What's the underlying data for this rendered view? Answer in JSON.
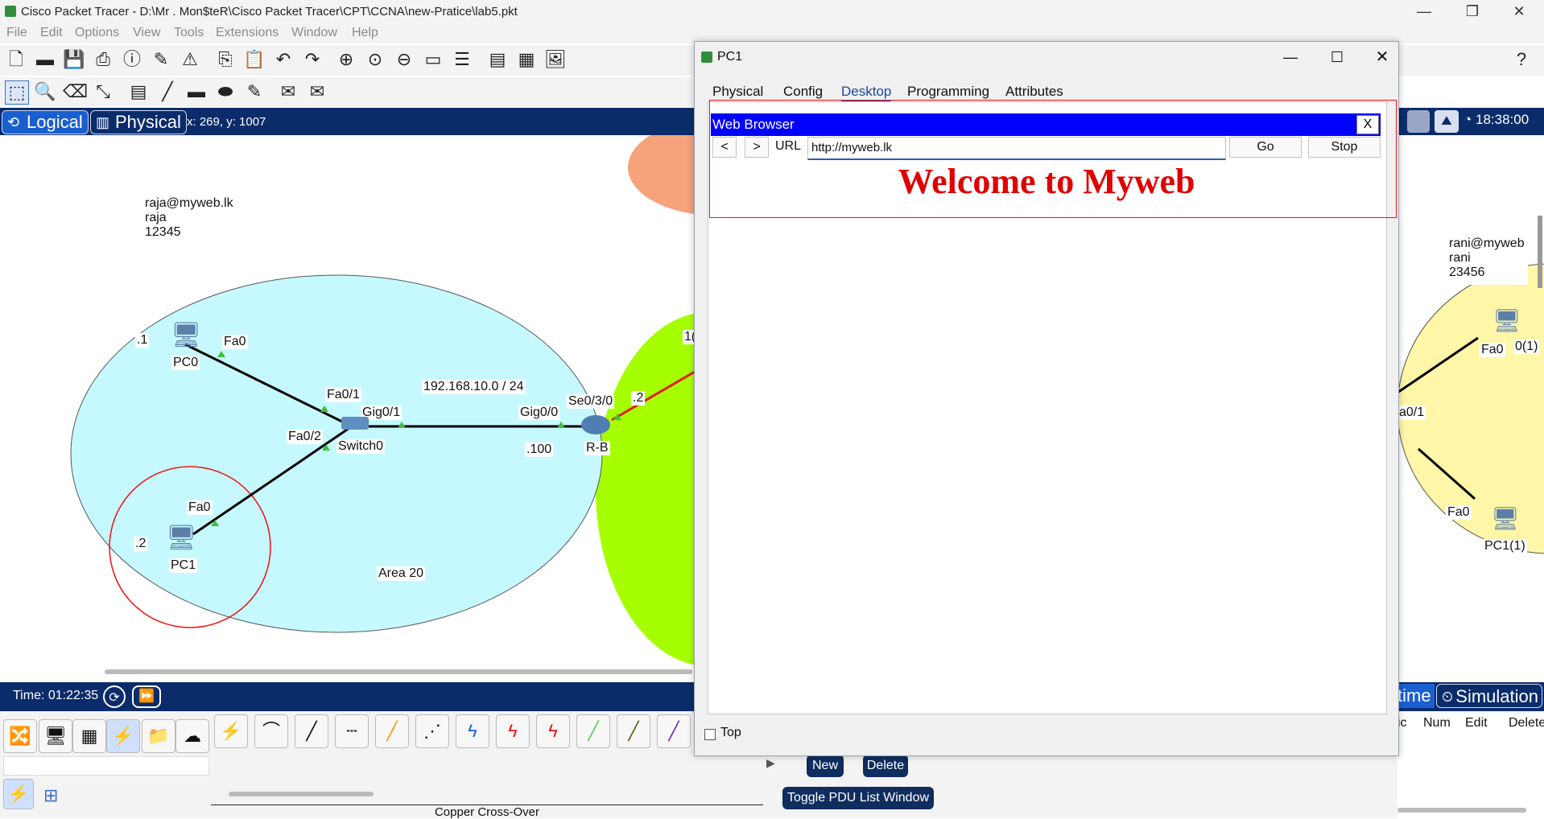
{
  "app": {
    "title": "Cisco Packet Tracer - D:\\Mr . Mon$teR\\Cisco Packet Tracer\\CPT\\CCNA\\new-Pratice\\lab5.pkt",
    "menu": [
      "File",
      "Edit",
      "Options",
      "View",
      "Tools",
      "Extensions",
      "Window",
      "Help"
    ]
  },
  "modes": {
    "logical": "Logical",
    "physical": "Physical",
    "coords": "x: 269, y: 1007",
    "clock": "18:38:00"
  },
  "topology": {
    "raja_note": [
      "raja@myweb.lk",
      "raja",
      "12345"
    ],
    "rani_note": [
      "rani@myweb",
      "rani",
      "23456"
    ],
    "devices": {
      "pc0": "PC0",
      "pc1": "PC1",
      "switch0": "Switch0",
      "router": "R-B",
      "pc1_1": "PC1(1)",
      "pc0_1": "0(1)"
    },
    "labels": {
      "pc0_port": "Fa0",
      "pc0_ip": ".1",
      "sw_fa01": "Fa0/1",
      "sw_gig01": "Gig0/1",
      "sw_fa02": "Fa0/2",
      "network": "192.168.10.0 / 24",
      "r_gig00": "Gig0/0",
      "r_se030": "Se0/3/0",
      "r_ip": ".2",
      "r_ip100": ".100",
      "pc1_port": "Fa0",
      "pc1_ip": ".2",
      "area": "Area 20",
      "right_fa0": "Fa0",
      "right_fa0_b": "Fa0",
      "right_port": "a0/1",
      "partial_ip": "1("
    }
  },
  "bottom": {
    "time_label": "Time: 01:22:35",
    "realtime": "time",
    "simulation": "Simulation",
    "new_btn": "New",
    "delete_btn": "Delete",
    "toggle_btn": "Toggle PDU List Window",
    "connection_label": "Copper Cross-Over",
    "pdu_headers": [
      "ic",
      "Num",
      "Edit",
      "Delete"
    ]
  },
  "pc_window": {
    "title": "PC1",
    "tabs": [
      "Physical",
      "Config",
      "Desktop",
      "Programming",
      "Attributes"
    ],
    "active_tab": "Desktop",
    "browser_title": "Web Browser",
    "close_label": "X",
    "back": "<",
    "forward": ">",
    "url_label": "URL",
    "url_value": "http://myweb.lk",
    "go": "Go",
    "stop": "Stop",
    "page_heading": "Welcome to Myweb",
    "top_checkbox": "Top"
  },
  "colors": {
    "area_cyan": "#c6f9ff",
    "area_green": "#a6ff00",
    "area_yellow": "#fff6a8",
    "area_orange": "#f6a27c",
    "link_red": "#e11d1d",
    "blue_bar": "#0b2c6b",
    "browser_bar": "#0000ff",
    "heading_red": "#e00000"
  }
}
